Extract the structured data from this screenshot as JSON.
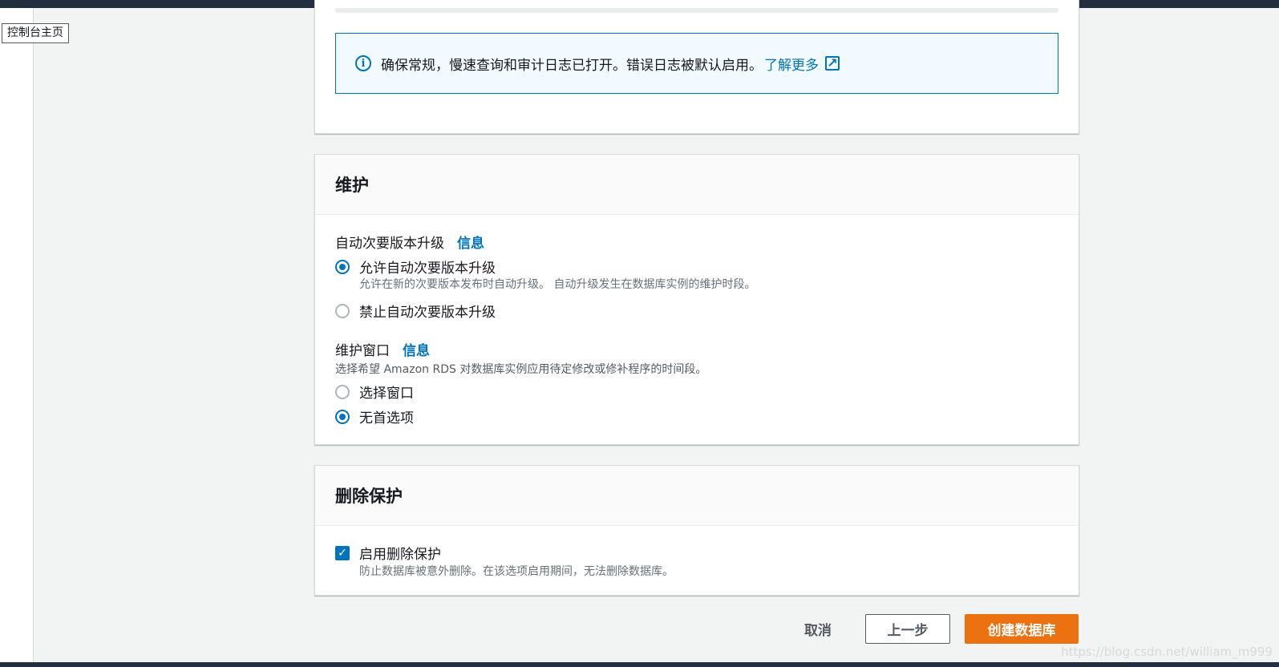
{
  "tooltip": "控制台主页",
  "logs_info": {
    "text": "确保常规，慢速查询和审计日志已打开。错误日志被默认启用。",
    "link": "了解更多"
  },
  "maintenance": {
    "title": "维护",
    "auto_upgrade": {
      "label": "自动次要版本升级",
      "info": "信息",
      "options": [
        {
          "label": "允许自动次要版本升级",
          "description": "允许在新的次要版本发布时自动升级。 自动升级发生在数据库实例的维护时段。",
          "selected": true
        },
        {
          "label": "禁止自动次要版本升级",
          "selected": false
        }
      ]
    },
    "window": {
      "label": "维护窗口",
      "info": "信息",
      "description": "选择希望 Amazon RDS 对数据库实例应用待定修改或修补程序的时间段。",
      "options": [
        {
          "label": "选择窗口",
          "selected": false
        },
        {
          "label": "无首选项",
          "selected": true
        }
      ]
    }
  },
  "deletion_protection": {
    "title": "删除保护",
    "checkbox_label": "启用删除保护",
    "checked": true,
    "description": "防止数据库被意外删除。在该选项启用期间，无法删除数据库。"
  },
  "actions": {
    "cancel": "取消",
    "previous": "上一步",
    "create": "创建数据库"
  },
  "watermark": "https://blog.csdn.net/william_m999",
  "colors": {
    "accent": "#0073bb",
    "primary_button": "#ec7211",
    "header_bar": "#232f3e"
  }
}
